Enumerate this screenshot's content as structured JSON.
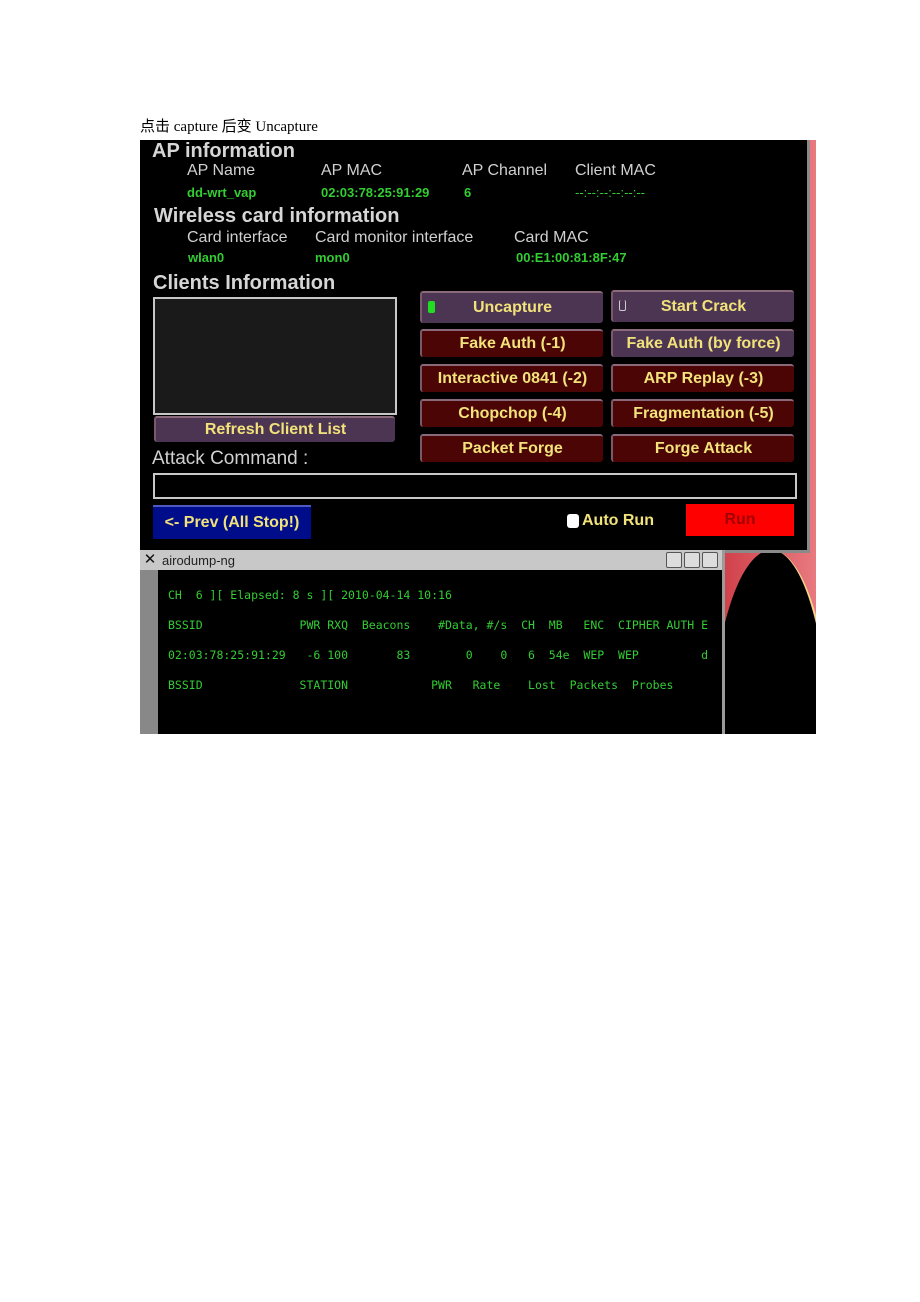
{
  "caption": "点击  capture 后变 Uncapture",
  "ap": {
    "title": "AP information",
    "labels": {
      "name": "AP Name",
      "mac": "AP MAC",
      "channel": "AP Channel",
      "client_mac": "Client MAC"
    },
    "values": {
      "name": "dd-wrt_vap",
      "mac": "02:03:78:25:91:29",
      "channel": "6",
      "client_mac": "--:--:--:--:--:--"
    }
  },
  "card": {
    "title": "Wireless card information",
    "labels": {
      "iface": "Card interface",
      "mon": "Card monitor interface",
      "mac": "Card MAC"
    },
    "values": {
      "iface": "wlan0",
      "mon": "mon0",
      "mac": "00:E1:00:81:8F:47"
    }
  },
  "clients": {
    "title": "Clients Information",
    "refresh_label": "Refresh Client List"
  },
  "buttons": {
    "uncapture": "Uncapture",
    "start_crack": "Start Crack",
    "fake_auth": "Fake Auth  (-1)",
    "fake_auth_force": "Fake Auth (by force)",
    "interactive": "Interactive 0841  (-2)",
    "arp_replay": "ARP Replay  (-3)",
    "chopchop": "Chopchop (-4)",
    "fragmentation": "Fragmentation (-5)",
    "packet_forge": "Packet Forge",
    "forge_attack": "Forge Attack"
  },
  "attack": {
    "label": "Attack Command :",
    "value": ""
  },
  "footer": {
    "prev_label": "<- Prev (All Stop!)",
    "auto_run_label": "Auto Run",
    "auto_run_checked": false,
    "run_label": "Run"
  },
  "terminal": {
    "title": "airodump-ng",
    "lines": [
      "CH  6 ][ Elapsed: 8 s ][ 2010-04-14 10:16",
      "BSSID              PWR RXQ  Beacons    #Data, #/s  CH  MB   ENC  CIPHER AUTH E",
      "02:03:78:25:91:29   -6 100       83        0    0   6  54e  WEP  WEP         d",
      "BSSID              STATION            PWR   Rate    Lost  Packets  Probes"
    ]
  }
}
